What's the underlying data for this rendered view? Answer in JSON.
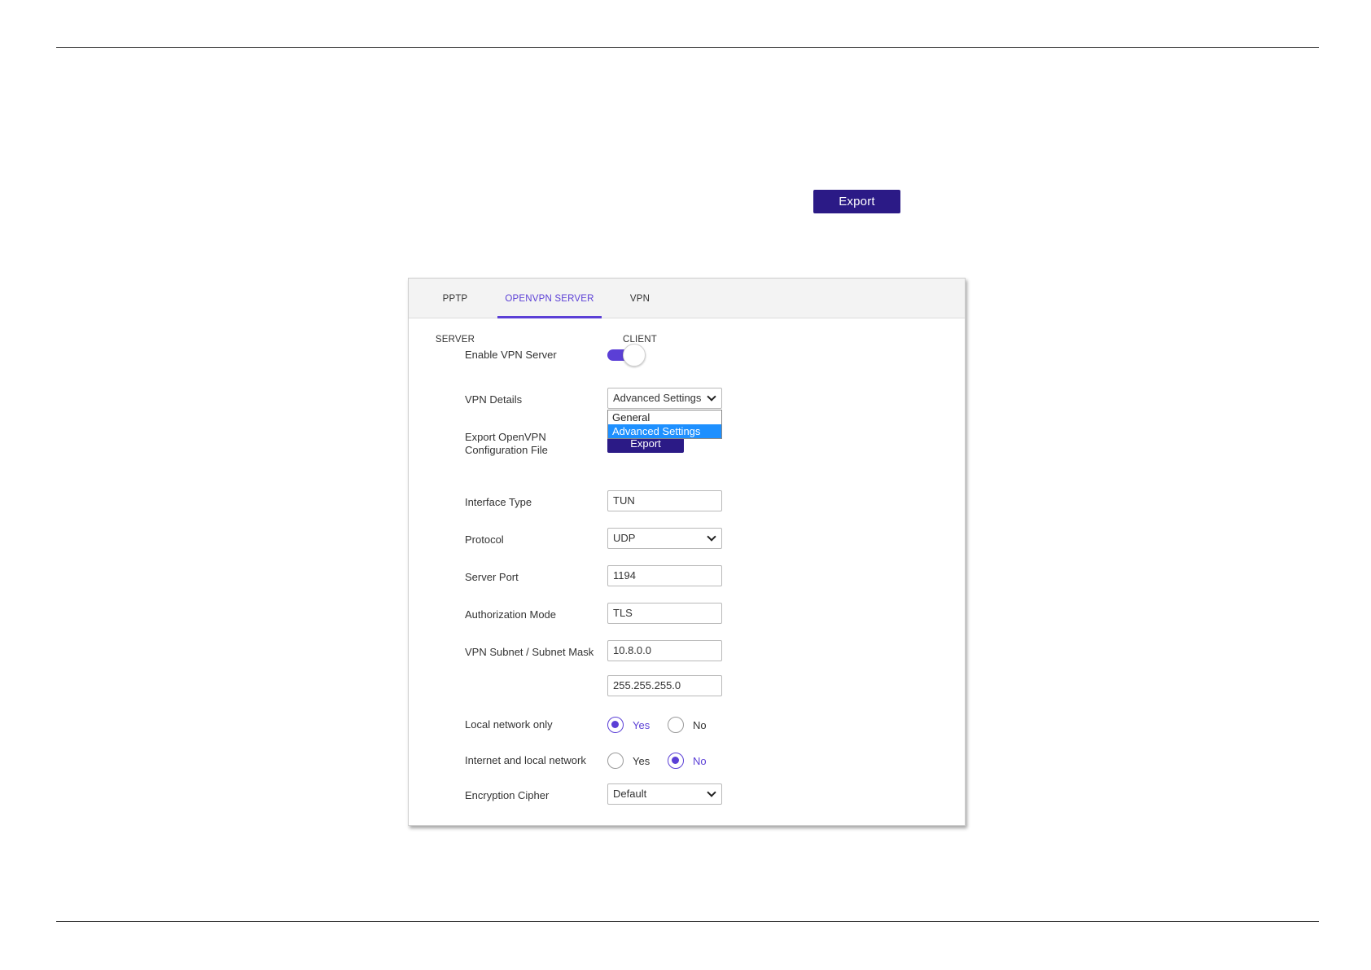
{
  "top_export_label": "Export",
  "tabs": [
    {
      "label": "PPTP SERVER",
      "active": false
    },
    {
      "label": "OPENVPN SERVER",
      "active": true
    },
    {
      "label": "VPN CLIENT",
      "active": false
    }
  ],
  "accent_color": "#5b3fd6",
  "button_color": "#2b1a86",
  "enable_vpn": {
    "label": "Enable VPN Server",
    "on": true
  },
  "vpn_details": {
    "label": "VPN Details",
    "value": "Advanced Settings",
    "options": [
      "General",
      "Advanced Settings"
    ],
    "selected_option": "Advanced Settings"
  },
  "export_config": {
    "label_line1": "Export OpenVPN",
    "label_line2": "Configuration File",
    "button": "Export"
  },
  "interface_type": {
    "label": "Interface Type",
    "value": "TUN"
  },
  "protocol": {
    "label": "Protocol",
    "value": "UDP"
  },
  "server_port": {
    "label": "Server Port",
    "value": "1194"
  },
  "auth_mode": {
    "label": "Authorization Mode",
    "value": "TLS"
  },
  "vpn_subnet": {
    "label": "VPN Subnet / Subnet Mask",
    "subnet": "10.8.0.0",
    "mask": "255.255.255.0"
  },
  "local_network_only": {
    "label": "Local network only",
    "yes": "Yes",
    "no": "No",
    "selected": "Yes"
  },
  "internet_and_local": {
    "label": "Internet and local network",
    "yes": "Yes",
    "no": "No",
    "selected": "No"
  },
  "encryption_cipher": {
    "label": "Encryption Cipher",
    "value": "Default"
  }
}
